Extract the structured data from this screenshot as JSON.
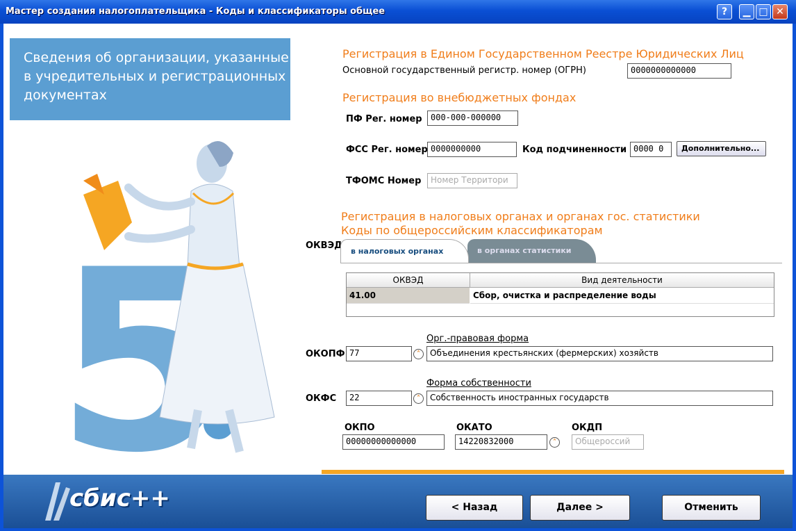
{
  "window": {
    "title": "Мастер создания налогоплательщика - Коды и классификаторы общее"
  },
  "left_panel": {
    "heading": "Сведения об организации, указанные в учредительных и регистрационных документах"
  },
  "egrul": {
    "section_title": "Регистрация в Едином Государственном Реестре Юридических Лиц",
    "ogrn_label": "Основной государственный регистр. номер (ОГРН)",
    "ogrn_value": "0000000000000"
  },
  "funds": {
    "section_title": "Регистрация во внебюджетных фондах",
    "pf_label": "ПФ Рег. номер",
    "pf_value": "000-000-000000",
    "fss_label": "ФСС Рег. номер",
    "fss_value": "0000000000",
    "kod_label": "Код подчиненности",
    "kod_value": "0000 0",
    "additional_button": "Дополнительно...",
    "tfoms_label": "ТФОМС Номер",
    "tfoms_placeholder": "Номер Территори"
  },
  "tax": {
    "section_title_1": "Регистрация в налоговых органах и органах гос. статистики",
    "section_title_2": "Коды по общероссийским классификаторам",
    "okved_label": "ОКВЭД",
    "tabs": [
      "в налоговых органах",
      "в органах статистики"
    ],
    "grid": {
      "columns": [
        "ОКВЭД",
        "Вид деятельности"
      ],
      "rows": [
        {
          "code": "41.00",
          "activity": "Сбор, очистка и распределение воды"
        }
      ]
    }
  },
  "okopf": {
    "caption": "Орг.-правовая форма",
    "label": "ОКОПФ",
    "code": "77",
    "name": "Объединения крестьянских (фермерских) хозяйств"
  },
  "okfs": {
    "caption": "Форма собственности",
    "label": "ОКФС",
    "code": "22",
    "name": "Собственность иностранных государств"
  },
  "codes": {
    "okpo_label": "ОКПО",
    "okpo_value": "00000000000000",
    "okato_label": "ОКАТО",
    "okato_value": "14220832000",
    "okdp_label": "ОКДП",
    "okdp_placeholder": "Общероссий"
  },
  "footer": {
    "logo": "сбис++",
    "back_button": "< Назад",
    "next_button": "Далее >",
    "cancel_button": "Отменить"
  },
  "colors": {
    "accent": "#f07d1a",
    "panel": "#5b9ed2",
    "titlebar": "#0a4fd4",
    "footer": "#1a4f96"
  }
}
